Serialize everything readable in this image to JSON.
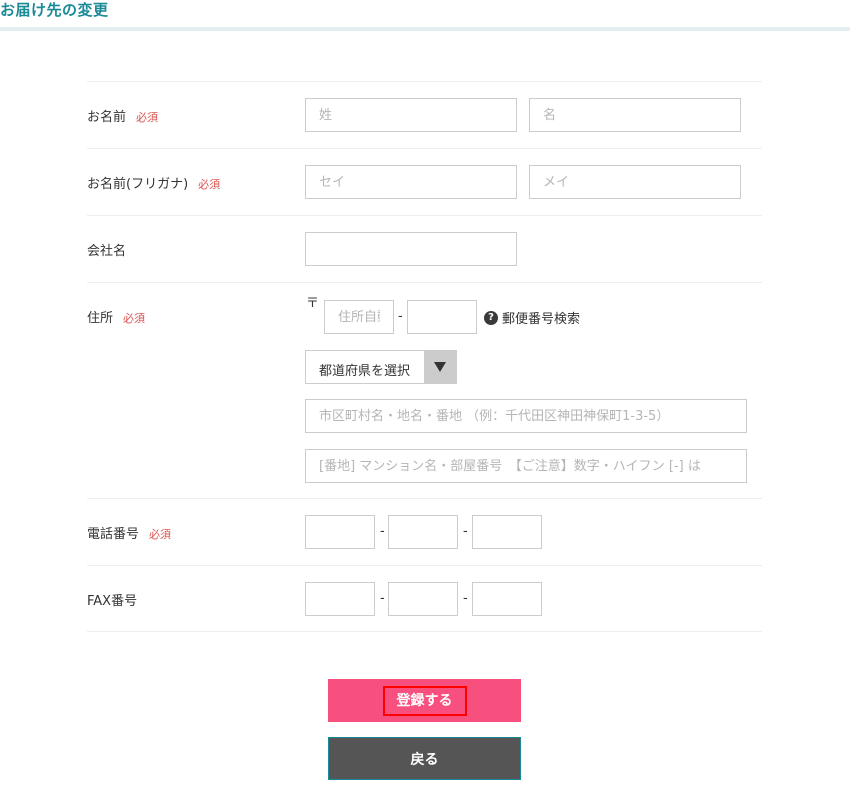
{
  "page": {
    "title": "お届け先の変更"
  },
  "required_label": "必須",
  "rows": {
    "name": {
      "label": "お名前",
      "last_placeholder": "姓",
      "first_placeholder": "名"
    },
    "kana": {
      "label": "お名前(フリガナ)",
      "last_placeholder": "セイ",
      "first_placeholder": "メイ"
    },
    "company": {
      "label": "会社名"
    },
    "address": {
      "label": "住所",
      "zip_mark": "〒",
      "zip1_placeholder": "住所自動入力",
      "zip_dash": "-",
      "zip_search_icon": "question-circle-icon",
      "zip_search_label": "郵便番号検索",
      "prefecture_selected": "都道府県を選択",
      "addr1_placeholder": "市区町村名・地名・番地 （例：千代田区神田神保町1-3-5）",
      "addr2_placeholder": "[番地] マンション名・部屋番号　【ご注意】数字・ハイフン [-] は"
    },
    "phone": {
      "label": "電話番号",
      "dash": "-"
    },
    "fax": {
      "label": "FAX番号",
      "dash": "-"
    }
  },
  "buttons": {
    "register": "登録する",
    "back": "戻る"
  },
  "colors": {
    "title": "#1a8a96",
    "required": "#d9534f",
    "register_button": "#f7507f",
    "back_button": "#555555"
  }
}
